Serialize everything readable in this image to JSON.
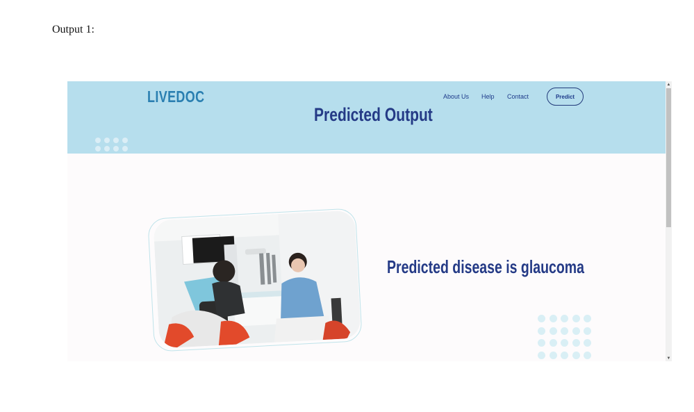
{
  "caption": "Output 1:",
  "header": {
    "brand": "LIVEDOC",
    "nav": [
      "About Us",
      "Help",
      "Contact"
    ],
    "predict_label": "Predict",
    "title": "Predicted Output"
  },
  "main": {
    "result": "Predicted disease is glaucoma",
    "photo_icon": "dentist-patient-photo"
  },
  "colors": {
    "hero_bg": "#b6deed",
    "brand": "#2a7fb1",
    "heading": "#243a86"
  }
}
